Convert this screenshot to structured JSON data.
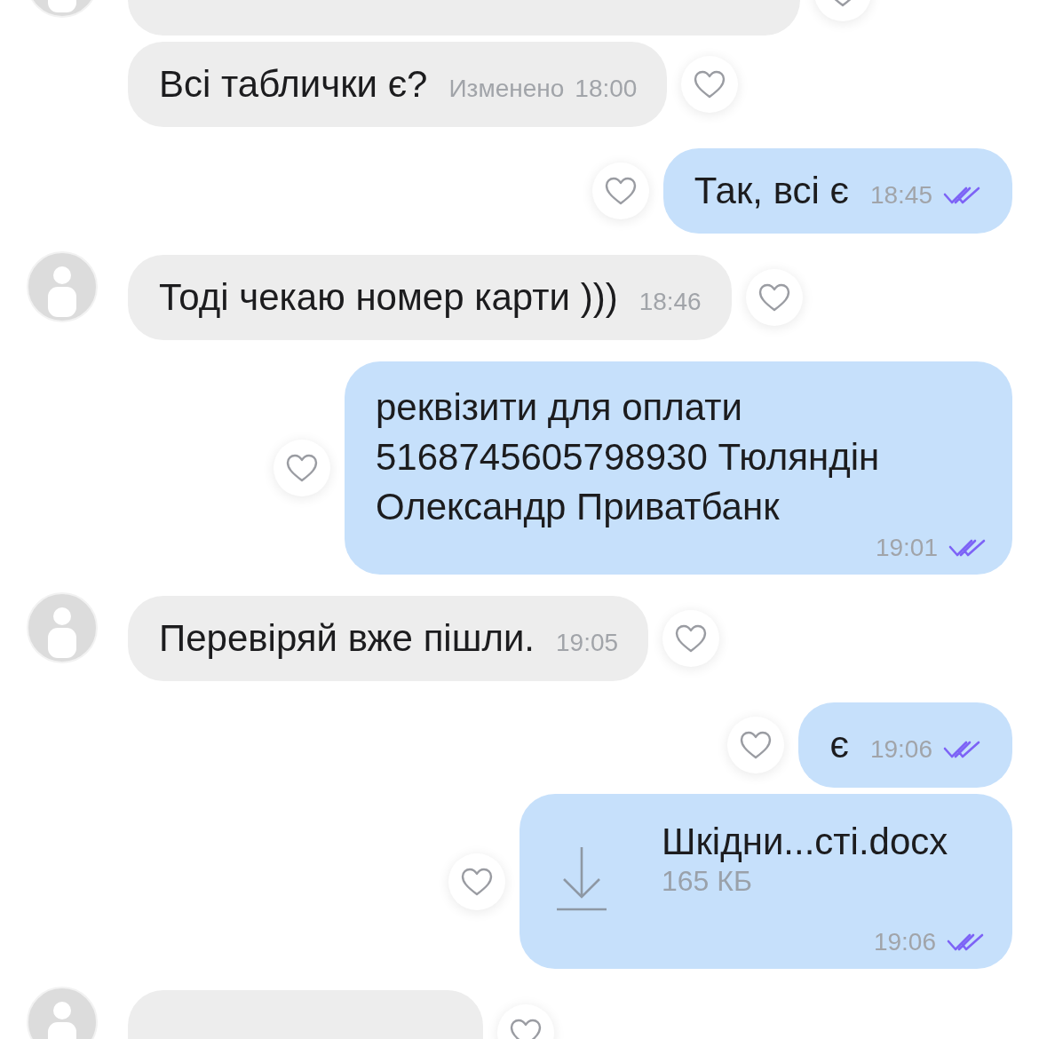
{
  "messages": [
    {
      "kind": "cut",
      "outgoing": false,
      "avatar": true
    },
    {
      "kind": "text",
      "outgoing": false,
      "avatar": false,
      "text": "Всі таблички є?",
      "edited_label": "Изменено",
      "time": "18:00"
    },
    {
      "kind": "text",
      "outgoing": true,
      "text": "Так, всі є",
      "time": "18:45",
      "read": true
    },
    {
      "kind": "text",
      "outgoing": false,
      "avatar": true,
      "text": "Тоді чекаю номер карти )))",
      "time": "18:46"
    },
    {
      "kind": "text",
      "outgoing": true,
      "text": "реквізити для оплати 5168745605798930 Тюляндін Олександр Приватбанк",
      "time": "19:01",
      "read": true
    },
    {
      "kind": "text",
      "outgoing": false,
      "avatar": true,
      "text": "Перевіряй вже пішли.",
      "time": "19:05"
    },
    {
      "kind": "text",
      "outgoing": true,
      "text": "є",
      "time": "19:06",
      "read": true
    },
    {
      "kind": "file",
      "outgoing": true,
      "file_name": "Шкідни...сті.docx",
      "file_size": "165 КБ",
      "time": "19:06",
      "read": true
    },
    {
      "kind": "cut",
      "outgoing": false,
      "avatar": true
    }
  ]
}
